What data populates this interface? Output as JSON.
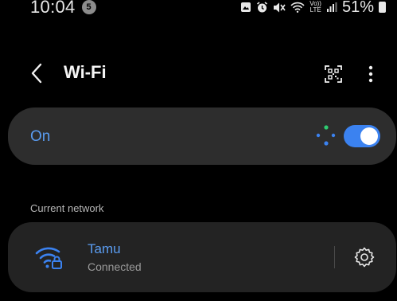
{
  "status_bar": {
    "time": "10:04",
    "notification_count": "5",
    "volte_line1": "Vo))",
    "volte_line2": "LTE",
    "battery_percent": "51%"
  },
  "header": {
    "title": "Wi-Fi",
    "back_icon": "chevron-left-icon",
    "qr_icon": "qr-scan-icon",
    "more_icon": "more-vertical-icon"
  },
  "wifi_toggle": {
    "label": "On",
    "enabled": true
  },
  "current_network": {
    "section_label": "Current network",
    "name": "Tamu",
    "status": "Connected",
    "icon": "wifi-lock-icon",
    "settings_icon": "gear-icon"
  },
  "colors": {
    "accent": "#3b82f0",
    "accent_text": "#5a9cf0",
    "card": "#2d2d2d",
    "card_dark": "#232323",
    "background": "#000000",
    "scan_green": "#2ecc71"
  }
}
